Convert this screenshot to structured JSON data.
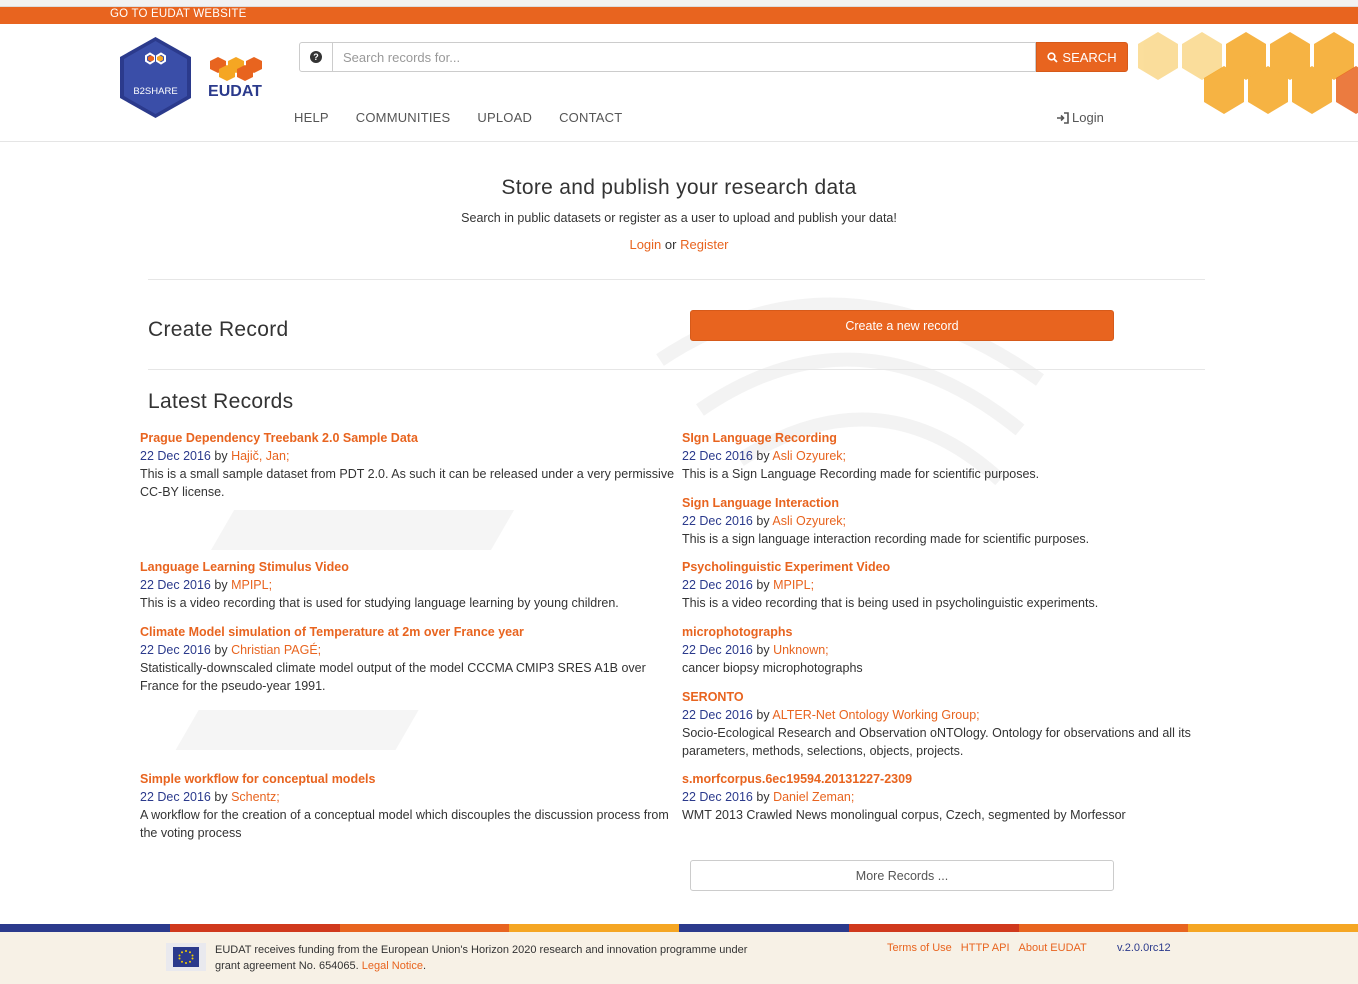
{
  "topbar": {
    "link_label": "GO TO EUDAT WEBSITE"
  },
  "logos": {
    "b2share": "B2SHARE",
    "eudat": "EUDAT"
  },
  "search": {
    "placeholder": "Search records for...",
    "button_label": "SEARCH"
  },
  "nav": {
    "items": [
      "HELP",
      "COMMUNITIES",
      "UPLOAD",
      "CONTACT"
    ],
    "login_label": "Login"
  },
  "hero": {
    "title": "Store and publish your research data",
    "subtitle": "Search in public datasets or register as a user to upload and publish your data!",
    "login_label": "Login",
    "or_text": "or",
    "register_label": "Register"
  },
  "create": {
    "title": "Create Record",
    "button_label": "Create a new record"
  },
  "latest": {
    "title": "Latest Records",
    "by_text": "by",
    "records": [
      {
        "title": "Prague Dependency Treebank 2.0 Sample Data",
        "date": "22 Dec 2016",
        "author": "Hajič, Jan;",
        "description": "This is a small sample dataset from PDT 2.0. As such it can be released under a very permissive CC-BY license."
      },
      {
        "title": "SIgn Language Recording",
        "date": "22 Dec 2016",
        "author": "Asli Ozyurek;",
        "description": "This is a Sign Language Recording made for scientific purposes."
      },
      {
        "title": "Sign Language Interaction",
        "date": "22 Dec 2016",
        "author": "Asli Ozyurek;",
        "description": "This is a sign language interaction recording made for scientific purposes."
      },
      {
        "title": "Language Learning Stimulus Video",
        "date": "22 Dec 2016",
        "author": "MPIPL;",
        "description": "This is a video recording that is used for studying language learning by young children."
      },
      {
        "title": "Psycholinguistic Experiment Video",
        "date": "22 Dec 2016",
        "author": "MPIPL;",
        "description": "This is a video recording that is being used in psycholinguistic experiments."
      },
      {
        "title": "Climate Model simulation of Temperature at 2m over France year",
        "date": "22 Dec 2016",
        "author": "Christian PAGÉ;",
        "description": "Statistically-downscaled climate model output of the model CCCMA CMIP3 SRES A1B over France for the pseudo-year 1991."
      },
      {
        "title": "microphotographs",
        "date": "22 Dec 2016",
        "author": "Unknown;",
        "description": "cancer biopsy microphotographs"
      },
      {
        "title": "SERONTO",
        "date": "22 Dec 2016",
        "author": "ALTER-Net Ontology Working Group;",
        "description": "Socio-Ecological Research and Observation oNTOlogy. Ontology for observations and all its parameters, methods, selections, objects, projects."
      },
      {
        "title": "Simple workflow for conceptual models",
        "date": "22 Dec 2016",
        "author": "Schentz;",
        "description": "A workflow for the creation of a conceptual model which discouples the discussion process from the voting process"
      },
      {
        "title": "s.morfcorpus.6ec19594.20131227-2309",
        "date": "22 Dec 2016",
        "author": "Daniel Zeman;",
        "description": "WMT 2013 Crawled News monolingual corpus, Czech, segmented by Morfessor"
      }
    ],
    "more_label": "More Records ..."
  },
  "footer": {
    "funding_text": "EUDAT receives funding from the European Union's Horizon 2020 research and innovation programme under grant agreement No. 654065.",
    "legal_label": "Legal Notice",
    "links": [
      "Terms of Use",
      "HTTP API",
      "About EUDAT"
    ],
    "version": "v.2.0.0rc12"
  },
  "colors": {
    "accent": "#e8641f",
    "navy": "#2b3a8c",
    "gold": "#f5a623",
    "red": "#d0391d",
    "footer_bg": "#f7f1e6"
  }
}
